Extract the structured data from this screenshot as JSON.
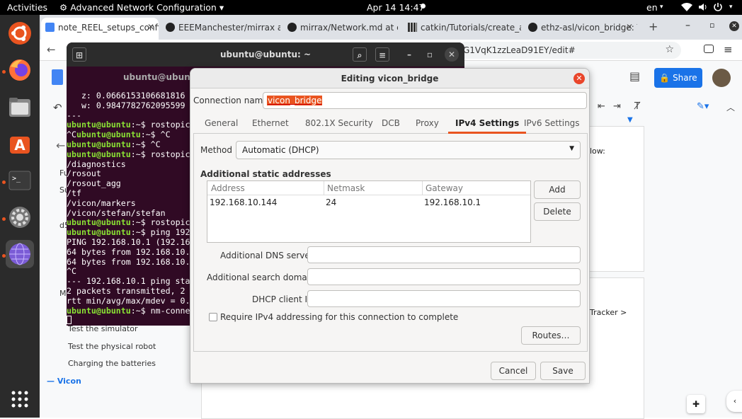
{
  "topbar": {
    "activities": "Activities",
    "app_menu": "Advanced Network Configuration",
    "clock": "Apr 14  14:47",
    "locale": "en"
  },
  "dock": {
    "apps": [
      "ubuntu-icon",
      "firefox-icon",
      "files-icon",
      "app-store-icon",
      "terminal-icon",
      "settings-icon",
      "network-icon"
    ],
    "grid": "show-apps-icon"
  },
  "browser": {
    "tabs": [
      {
        "label": "note_REEL_setups_confi",
        "active": true
      },
      {
        "label": "EEEManchester/mirrax at c"
      },
      {
        "label": "mirrax/Network.md at c"
      },
      {
        "label": "catkin/Tutorials/create_a"
      },
      {
        "label": "ethz-asl/vicon_bridge: Th"
      }
    ],
    "url": "G1VqK1zzLeaD91EY/edit#",
    "share_label": "Share"
  },
  "docs": {
    "outline": [
      "Test the simulator",
      "Test the physical robot",
      "Charging the batteries",
      "Vicon"
    ],
    "side_fragments": [
      "Fu",
      "Su",
      "d5",
      "M"
    ],
    "page_fragments": [
      "low:",
      "Tracker >"
    ]
  },
  "terminal": {
    "title": "ubuntu@ubuntu: ~",
    "lines": [
      {
        "t": "   z: 0.0666153106681816"
      },
      {
        "t": "   w: 0.9847782762095599"
      },
      {
        "t": "---"
      },
      {
        "p": "ubuntu@ubuntu",
        "c": ":~$ rostopic"
      },
      {
        "t": "^C",
        "p": "ubuntu@ubuntu",
        "c": ":~$ ^C"
      },
      {
        "p": "ubuntu@ubuntu",
        "c": ":~$ ^C"
      },
      {
        "p": "ubuntu@ubuntu",
        "c": ":~$ rostopic"
      },
      {
        "t": "/diagnostics"
      },
      {
        "t": "/rosout"
      },
      {
        "t": "/rosout_agg"
      },
      {
        "t": "/tf"
      },
      {
        "t": "/vicon/markers"
      },
      {
        "t": "/vicon/stefan/stefan"
      },
      {
        "p": "ubuntu@ubuntu",
        "c": ":~$ rostopic"
      },
      {
        "p": "ubuntu@ubuntu",
        "c": ":~$ ping 192"
      },
      {
        "t": "PING 192.168.10.1 (192.16"
      },
      {
        "t": "64 bytes from 192.168.10."
      },
      {
        "t": "64 bytes from 192.168.10."
      },
      {
        "t": "^C"
      },
      {
        "t": "--- 192.168.10.1 ping sta"
      },
      {
        "t": "2 packets transmitted, 2"
      },
      {
        "t": "rtt min/avg/max/mdev = 0."
      },
      {
        "p": "ubuntu@ubuntu",
        "c": ":~$ nm-conne"
      }
    ]
  },
  "dialog": {
    "title": "Editing vicon_bridge",
    "behind_title": "ubuntu@ubuntu: ~",
    "connection_name_label": "Connection name",
    "connection_name_value": "vicon_bridge",
    "tabs": [
      "General",
      "Ethernet",
      "802.1X Security",
      "DCB",
      "Proxy",
      "IPv4 Settings",
      "IPv6 Settings"
    ],
    "active_tab": "IPv4 Settings",
    "method_label": "Method",
    "method_value": "Automatic (DHCP)",
    "static_heading": "Additional static addresses",
    "columns": [
      "Address",
      "Netmask",
      "Gateway"
    ],
    "rows": [
      [
        "192.168.10.144",
        "24",
        "192.168.10.1"
      ]
    ],
    "add_label": "Add",
    "delete_label": "Delete",
    "dns_label": "Additional DNS servers",
    "search_label": "Additional search domains",
    "dhcp_label": "DHCP client ID",
    "require_label": "Require IPv4 addressing for this connection to complete",
    "routes_label": "Routes…",
    "cancel_label": "Cancel",
    "save_label": "Save"
  },
  "colors": {
    "accent": "#e95420",
    "share": "#1a73e8",
    "terminal_bg": "#300a24"
  }
}
